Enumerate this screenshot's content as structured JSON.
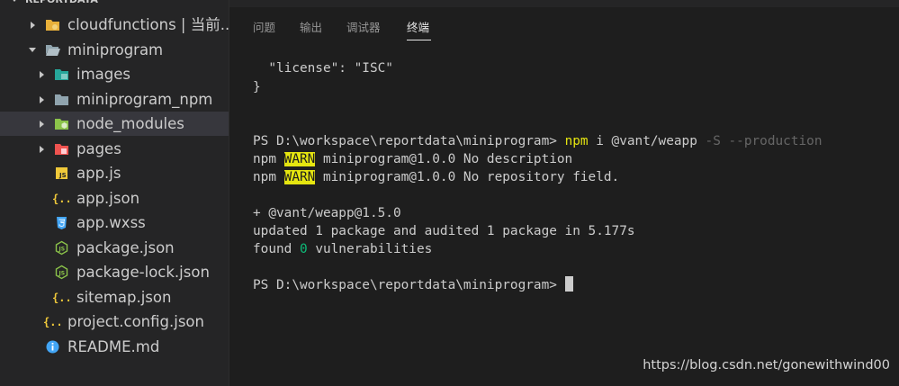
{
  "explorer": {
    "section_title": "REPORTDATA",
    "items": [
      {
        "label": "cloudfunctions | 当前...",
        "icon": "cloud-folder-icon",
        "expanded": false,
        "selected": false
      },
      {
        "label": "miniprogram",
        "icon": "folder-open-icon",
        "expanded": true,
        "selected": false
      },
      {
        "label": "images",
        "icon": "images-folder-icon",
        "expanded": false,
        "selected": false
      },
      {
        "label": "miniprogram_npm",
        "icon": "folder-icon",
        "expanded": false,
        "selected": false
      },
      {
        "label": "node_modules",
        "icon": "node-folder-icon",
        "expanded": false,
        "selected": true
      },
      {
        "label": "pages",
        "icon": "pages-folder-icon",
        "expanded": false,
        "selected": false
      },
      {
        "label": "app.js",
        "icon": "js-file-icon"
      },
      {
        "label": "app.json",
        "icon": "json-file-icon"
      },
      {
        "label": "app.wxss",
        "icon": "css-file-icon"
      },
      {
        "label": "package.json",
        "icon": "node-file-icon"
      },
      {
        "label": "package-lock.json",
        "icon": "node-file-icon"
      },
      {
        "label": "sitemap.json",
        "icon": "json-file-icon"
      },
      {
        "label": "project.config.json",
        "icon": "json-file-icon"
      },
      {
        "label": "README.md",
        "icon": "info-icon"
      }
    ]
  },
  "panel": {
    "tabs": [
      {
        "label": "问题",
        "active": false
      },
      {
        "label": "输出",
        "active": false
      },
      {
        "label": "调试器",
        "active": false
      },
      {
        "label": "终端",
        "active": true
      }
    ]
  },
  "terminal": {
    "lines": {
      "license": "  \"license\": \"ISC\"",
      "brace": "}",
      "prompt1": "PS D:\\workspace\\reportdata\\miniprogram> ",
      "cmd_npm": "npm",
      "cmd_args": " i @vant/weapp ",
      "cmd_flags": "-S --production",
      "npm_prefix": "npm ",
      "warn_tag": "WARN",
      "warn1_text": " miniprogram@1.0.0 No description",
      "warn2_text": " miniprogram@1.0.0 No repository field.",
      "added": "+ @vant/weapp@1.5.0",
      "updated": "updated 1 package and audited 1 package in 5.177s",
      "found_prefix": "found ",
      "found_count": "0",
      "found_suffix": " vulnerabilities",
      "prompt2": "PS D:\\workspace\\reportdata\\miniprogram> "
    }
  },
  "watermark": "https://blog.csdn.net/gonewithwind00",
  "colors": {
    "sidebar_bg": "#252526",
    "editor_bg": "#1e1e1e",
    "selected_row": "#37373d",
    "warn_highlight": "#e5e510",
    "success_green": "#0dbc79"
  }
}
